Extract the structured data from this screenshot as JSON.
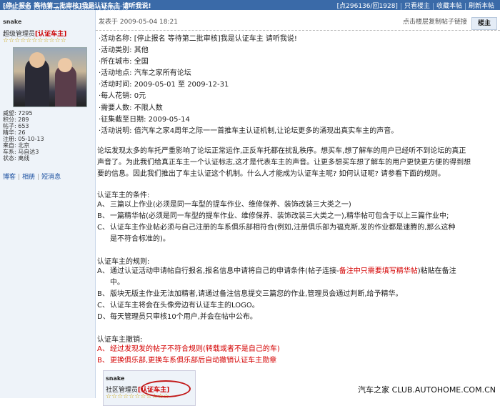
{
  "topbar": {
    "title": "[停止报名 等待第二批审核]我是认证车主 请听我说!",
    "watermark": "汽车之家 CLUB.AUTOHOME.COM.CN",
    "stats": "[点296136/回1928]",
    "only_host": "只看楼主",
    "favorite": "收藏本帖",
    "refresh": "刷新本帖"
  },
  "user": {
    "name": "snake",
    "role_prefix": "超级管理员",
    "role_badge": "[认证车主]",
    "stars": "☆☆☆☆☆☆☆☆☆☆☆",
    "stats": [
      "威望: 7295",
      "积分: 289",
      "帖子: 653",
      "精华: 26",
      "注册: 05-10-13",
      "来自: 北京",
      "车系: 马自达3",
      "状态: 离线"
    ],
    "links": [
      "博客",
      "相册",
      "短消息"
    ]
  },
  "post": {
    "posted_at": "发表于 2009-05-04 18:21",
    "copy_link": "点击楼层复制帖子链接",
    "floor": "楼主",
    "info": [
      "·活动名称: [停止报名 等待第二批审核]我是认证车主 请听我说!",
      "·活动类别: 其他",
      "·所在城市: 全国",
      "·活动地点: 汽车之家所有论坛",
      "·活动时间: 2009-05-01 至 2009-12-31",
      "·每人花销: 0元",
      "·需要人数: 不限人数",
      "·征集截至日期: 2009-05-14",
      "·活动说明: 值汽车之家4周年之际一一首推车主认证机制,让论坛更多的涌现出真实车主的声音。"
    ],
    "intro": [
      "论坛发现太多的车托严重影响了论坛正常运作,正反车托都在扰乱秩序。想买车,想了解车的用户已经听不到论坛的真正",
      "声音了。为此我们给真正车主一个认证标志,这才是代表车主的声音。让更多想买车想了解车的用户更快更方便的得到想",
      "要的信息。因此我们推出了车主认证这个机制。什么人才能成为认证车主呢? 如何认证呢? 请参看下面的规则。"
    ],
    "conditions_title": "认证车主的条件:",
    "conditions": [
      {
        "label": "A、",
        "lines": [
          "三篇以上作业(必须是同一车型的提车作业、维修保养、装饰改装三大类之一)"
        ]
      },
      {
        "label": "B、",
        "lines": [
          "一篇精华帖(必须是同一车型的提车作业、维修保养、装饰改装三大类之一),精华帖可包含于以上三篇作业中;"
        ]
      },
      {
        "label": "C、",
        "lines": [
          "认证车主作业帖必须与自己注册的车系俱乐部相符合(例如,注册俱乐部为福克斯,发的作业都是速腾的,那么这种",
          "是不符合标准的)。"
        ]
      }
    ],
    "rules_title": "认证车主的规则:",
    "rules": [
      {
        "label": "A、",
        "pre": "通过认证活动申请帖自行报名,报名信息中请将自己的申请条件(帖子连接-",
        "highlight": "备注中只需要填写精华帖",
        "post": ")粘贴在备注",
        "line2": "中。"
      },
      {
        "label": "B、",
        "pre": "版块无版主作业无法加精者,请通过备注信息提交三篇您的作业,管理员会通过判断,给予精华。"
      },
      {
        "label": "C、",
        "pre": "认证车主将会在头像旁边有认证车主的LOGO。"
      },
      {
        "label": "D、",
        "pre": "每天管理员只审核10个用户,并会在帖中公布。"
      }
    ],
    "revoke_title": "认证车主撤销:",
    "revoke": [
      {
        "label": "A、",
        "text": "经过发现发的帖子不符合规则(转载或者不是自己的车)"
      },
      {
        "label": "B、",
        "text": "更换俱乐部,更换车系俱乐部后自动撤销认证车主勋章"
      }
    ]
  },
  "signature": {
    "name": "snake",
    "role_prefix": "社区管理员",
    "role_badge": "[认证车主]",
    "stars": "☆☆☆☆☆☆☆☆☆☆☆"
  },
  "footer": "汽车之家 CLUB.AUTOHOME.COM.CN"
}
